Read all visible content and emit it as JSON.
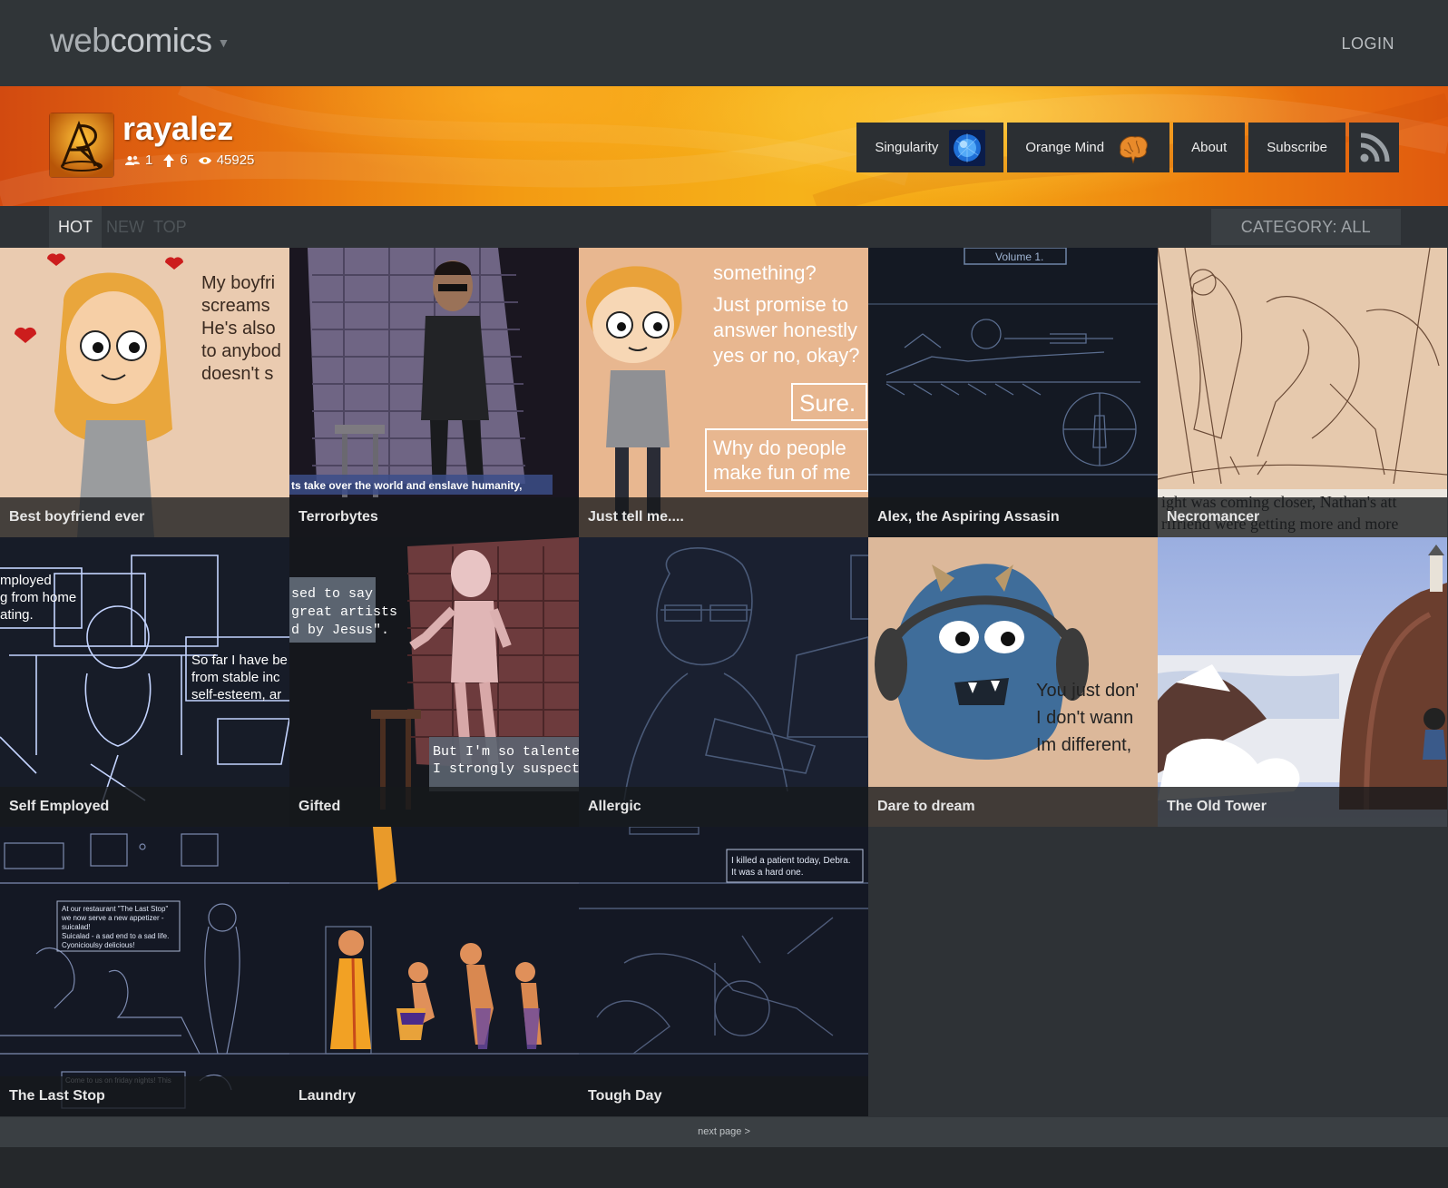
{
  "header": {
    "brand_light": "web",
    "brand_bold": "comics",
    "login_label": "LOGIN"
  },
  "profile": {
    "username": "rayalez",
    "stats": {
      "followers": "1",
      "upvotes": "6",
      "views": "45925"
    },
    "nav": [
      {
        "label": "Singularity",
        "icon": "singularity-thumbnail"
      },
      {
        "label": "Orange Mind",
        "icon": "brain-thumbnail"
      },
      {
        "label": "About"
      },
      {
        "label": "Subscribe"
      },
      {
        "icon": "rss-icon"
      }
    ]
  },
  "filters": {
    "tabs": [
      "HOT",
      "NEW",
      "TOP"
    ],
    "active_tab": "HOT",
    "category_label": "CATEGORY: ALL"
  },
  "comics": [
    {
      "title": "Best boyfriend ever"
    },
    {
      "title": "Terrorbytes"
    },
    {
      "title": "Just tell me...."
    },
    {
      "title": "Alex, the Aspiring Assasin"
    },
    {
      "title": "Necromancer"
    },
    {
      "title": "Self Employed"
    },
    {
      "title": "Gifted"
    },
    {
      "title": "Allergic"
    },
    {
      "title": "Dare to dream"
    },
    {
      "title": "The Old Tower"
    },
    {
      "title": "The Last Stop"
    },
    {
      "title": "Laundry"
    },
    {
      "title": "Tough Day"
    }
  ],
  "pager": {
    "next_label": "next page >"
  },
  "colors": {
    "topbar": "#303538",
    "banner_orange": "#f39a12",
    "button_dark": "#2b2f33",
    "tile_dark": "#141820"
  }
}
